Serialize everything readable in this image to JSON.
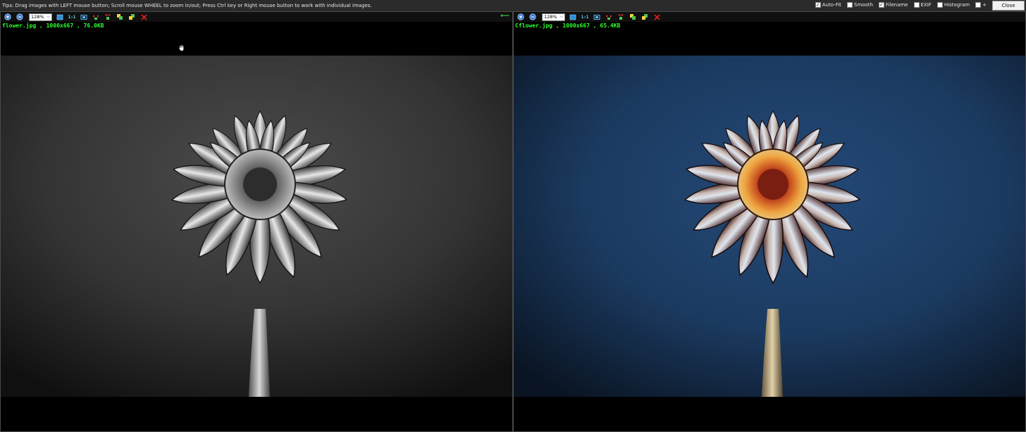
{
  "topbar": {
    "tips": "Tips: Drag images with LEFT mouse button; Scroll mouse WHEEL to zoom in/out; Press Ctrl key or Right mouse button to work with individual images.",
    "options": [
      {
        "label": "Auto-Fit",
        "checked": true
      },
      {
        "label": "Smooth",
        "checked": false
      },
      {
        "label": "Filename",
        "checked": true
      },
      {
        "label": "EXIF",
        "checked": false
      },
      {
        "label": "Histogram",
        "checked": false
      },
      {
        "label": "+",
        "checked": false
      }
    ],
    "close_label": "Close"
  },
  "left_pane": {
    "zoom": "128%",
    "one_to_one": "1:1",
    "file_info": "flower.jpg , 1000x667 , 76.0KB"
  },
  "right_pane": {
    "zoom": "128%",
    "one_to_one": "1:1",
    "file_info": "Cflower.jpg , 1000x667 , 65.4KB"
  },
  "icons": {
    "zoom_in": "zoom-in-icon",
    "zoom_out": "zoom-out-icon",
    "fit": "fit-to-window-icon",
    "flip_h": "flip-horizontal-icon",
    "flip_v": "flip-vertical-icon",
    "rotate_left": "rotate-left-icon",
    "rotate_right": "rotate-right-icon",
    "close_image": "close-image-icon",
    "sync": "sync-arrow-icon",
    "cursor": "hand-cursor-icon"
  },
  "colors": {
    "file_info": "#2cff2c",
    "topbar_bg": "#2b2b2b",
    "close_x": "#e02020"
  }
}
